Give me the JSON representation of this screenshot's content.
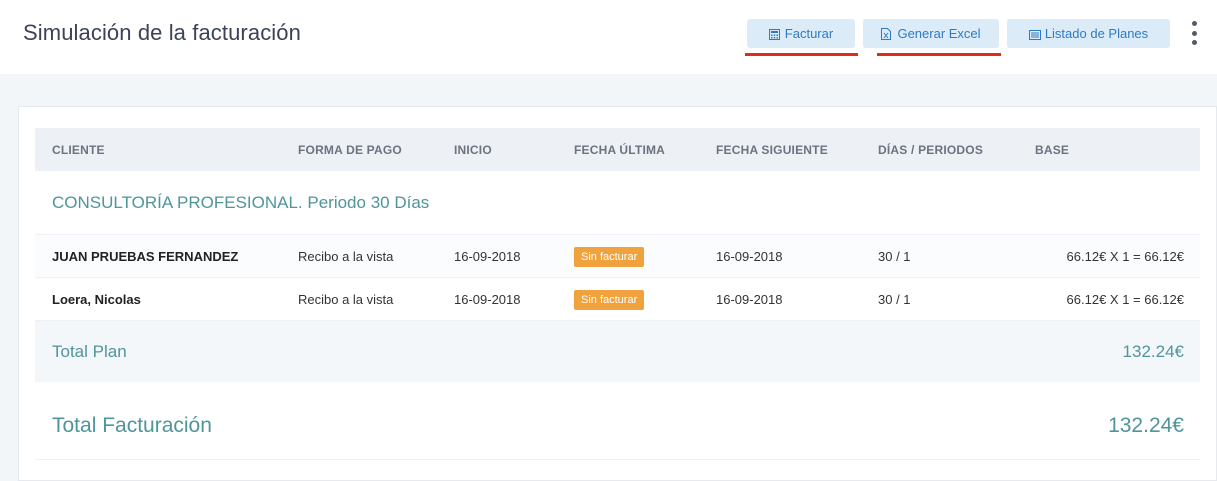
{
  "header": {
    "title": "Simulación de la facturación",
    "buttons": {
      "facturar": {
        "label": "Facturar",
        "icon": "calculator-icon"
      },
      "excel": {
        "label": "Generar Excel",
        "icon": "excel-file-icon"
      },
      "planes": {
        "label": "Listado de Planes",
        "icon": "list-icon"
      }
    },
    "menu_icon": "kebab-menu-icon",
    "highlight_color": "#e32b1b"
  },
  "table": {
    "columns": [
      "CLIENTE",
      "FORMA DE PAGO",
      "INICIO",
      "FECHA ÚLTIMA",
      "FECHA SIGUIENTE",
      "DÍAS / PERIODOS",
      "BASE"
    ],
    "group_title": "CONSULTORÍA PROFESIONAL. Periodo 30 Días",
    "rows": [
      {
        "cliente": "JUAN PRUEBAS FERNANDEZ",
        "forma_pago": "Recibo a la vista",
        "inicio": "16-09-2018",
        "fecha_ultima": "Sin facturar",
        "fecha_siguiente": "16-09-2018",
        "dias_periodos": "30 / 1",
        "base": "66.12€ X 1 = 66.12€"
      },
      {
        "cliente": "Loera, Nicolas",
        "forma_pago": "Recibo a la vista",
        "inicio": "16-09-2018",
        "fecha_ultima": "Sin facturar",
        "fecha_siguiente": "16-09-2018",
        "dias_periodos": "30 / 1",
        "base": "66.12€ X 1 = 66.12€"
      }
    ],
    "total_plan": {
      "label": "Total Plan",
      "value": "132.24€"
    },
    "total_facturacion": {
      "label": "Total Facturación",
      "value": "132.24€"
    }
  },
  "colors": {
    "accent": "#4f959b",
    "button_bg": "#dcebf8",
    "button_text": "#2e7bc4",
    "badge": "#f0a33c"
  }
}
